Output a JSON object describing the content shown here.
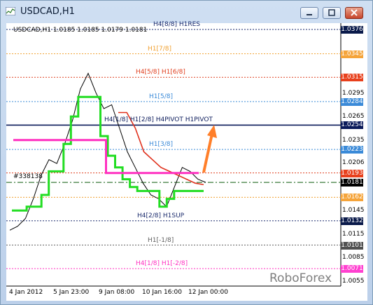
{
  "window": {
    "title": "USDCAD,H1"
  },
  "info_line": "USDCAD,H1  1.0185 1.0185 1.0179 1.0181",
  "brand": "RoboForex",
  "side_note": "#338138",
  "levels": [
    {
      "label": "H4[8/8] H1RES",
      "price": "1.0376",
      "color": "#1a2a6c",
      "tag_bg": "#0a1a4a",
      "tag_fg": "#ffffff",
      "style": "dotted"
    },
    {
      "label": "H1[7/8]",
      "price": "1.0345",
      "color": "#f0a030",
      "tag_bg": "#f5a43a",
      "tag_fg": "#ffffff",
      "style": "dotted"
    },
    {
      "label": "H4[5/8] H1[6/8]",
      "price": "1.0315",
      "color": "#e04020",
      "tag_bg": "#e8401c",
      "tag_fg": "#ffffff",
      "style": "dotted"
    },
    {
      "label": "H1[5/8]",
      "price": "1.0284",
      "color": "#3a8ad8",
      "tag_bg": "#3a8ad8",
      "tag_fg": "#ffffff",
      "style": "dotted"
    },
    {
      "label": "H4[1/8] H1[2/8] H4PIVOT H1PIVOT",
      "price": "1.0254",
      "color": "#0a1a5a",
      "tag_bg": "#0a1a5a",
      "tag_fg": "#ffffff",
      "style": "solid"
    },
    {
      "label": "H1[3/8]",
      "price": "1.0223",
      "color": "#3a8ad8",
      "tag_bg": "#3a8ad8",
      "tag_fg": "#ffffff",
      "style": "dotted"
    },
    {
      "label": "",
      "price": "1.0193",
      "color": "#e04020",
      "tag_bg": "#e8401c",
      "tag_fg": "#ffffff",
      "style": "dotted"
    },
    {
      "label": "",
      "price": "1.0181",
      "color": "#0a5a0a",
      "tag_bg": "#000000",
      "tag_fg": "#ffffff",
      "style": "dashdot"
    },
    {
      "label": "",
      "price": "1.0162",
      "color": "#f0a030",
      "tag_bg": "#f5a43a",
      "tag_fg": "#ffffff",
      "style": "dotted"
    },
    {
      "label": "H4[2/8] H1SUP",
      "price": "1.0132",
      "color": "#1a2a6c",
      "tag_bg": "#0a1a4a",
      "tag_fg": "#ffffff",
      "style": "dotted"
    },
    {
      "label": "H1[-1/8]",
      "price": "1.0101",
      "color": "#606060",
      "tag_bg": "#505050",
      "tag_fg": "#ffffff",
      "style": "dotted"
    },
    {
      "label": "H4[1/8] H1[-2/8]",
      "price": "1.0071",
      "color": "#ff30c0",
      "tag_bg": "#ff40d0",
      "tag_fg": "#ffffff",
      "style": "dotted"
    }
  ],
  "y_axis": [
    "1.0295",
    "1.0265",
    "1.0235",
    "1.0206",
    "1.0145",
    "1.0115",
    "1.0085",
    "1.0055"
  ],
  "x_axis": [
    "4 Jan 2012",
    "5 Jan 23:00",
    "9 Jan 08:00",
    "10 Jan 16:00",
    "12 Jan 00:00"
  ],
  "chart_data": {
    "type": "line",
    "x": [
      "4 Jan 2012",
      "5 Jan 23:00",
      "9 Jan 08:00",
      "10 Jan 16:00",
      "12 Jan 00:00"
    ],
    "series": [
      {
        "name": "",
        "color": "#000000",
        "values": [
          1.012,
          1.0125,
          1.0135,
          1.016,
          1.019,
          1.021,
          1.0205,
          1.023,
          1.026,
          1.03,
          1.032,
          1.0295,
          1.0275,
          1.028,
          1.025,
          1.022,
          1.02,
          1.018,
          1.0165,
          1.016,
          1.015,
          1.0175,
          1.02,
          1.0195,
          1.0185,
          1.0181
        ]
      },
      {
        "name": "",
        "color": "#22dd22",
        "values": [
          1.0145,
          1.0145,
          1.015,
          1.015,
          1.0165,
          1.0195,
          1.0195,
          1.023,
          1.0265,
          1.029,
          1.029,
          1.029,
          1.024,
          1.0215,
          1.02,
          1.0185,
          1.0175,
          1.017,
          1.017,
          1.017,
          1.015,
          1.016,
          1.017,
          1.017,
          1.017,
          1.017
        ]
      },
      {
        "name": "",
        "color": "#e0301c",
        "values": [
          1.027,
          1.027,
          1.025,
          1.022,
          1.021,
          1.02,
          1.0195,
          1.019,
          1.0185,
          1.018,
          1.0178
        ]
      },
      {
        "name": "",
        "color": "#ff30c0",
        "values": [
          1.0235,
          1.0235,
          1.0235,
          1.0235,
          1.0193,
          1.0193,
          1.0193,
          1.0193
        ]
      }
    ]
  }
}
